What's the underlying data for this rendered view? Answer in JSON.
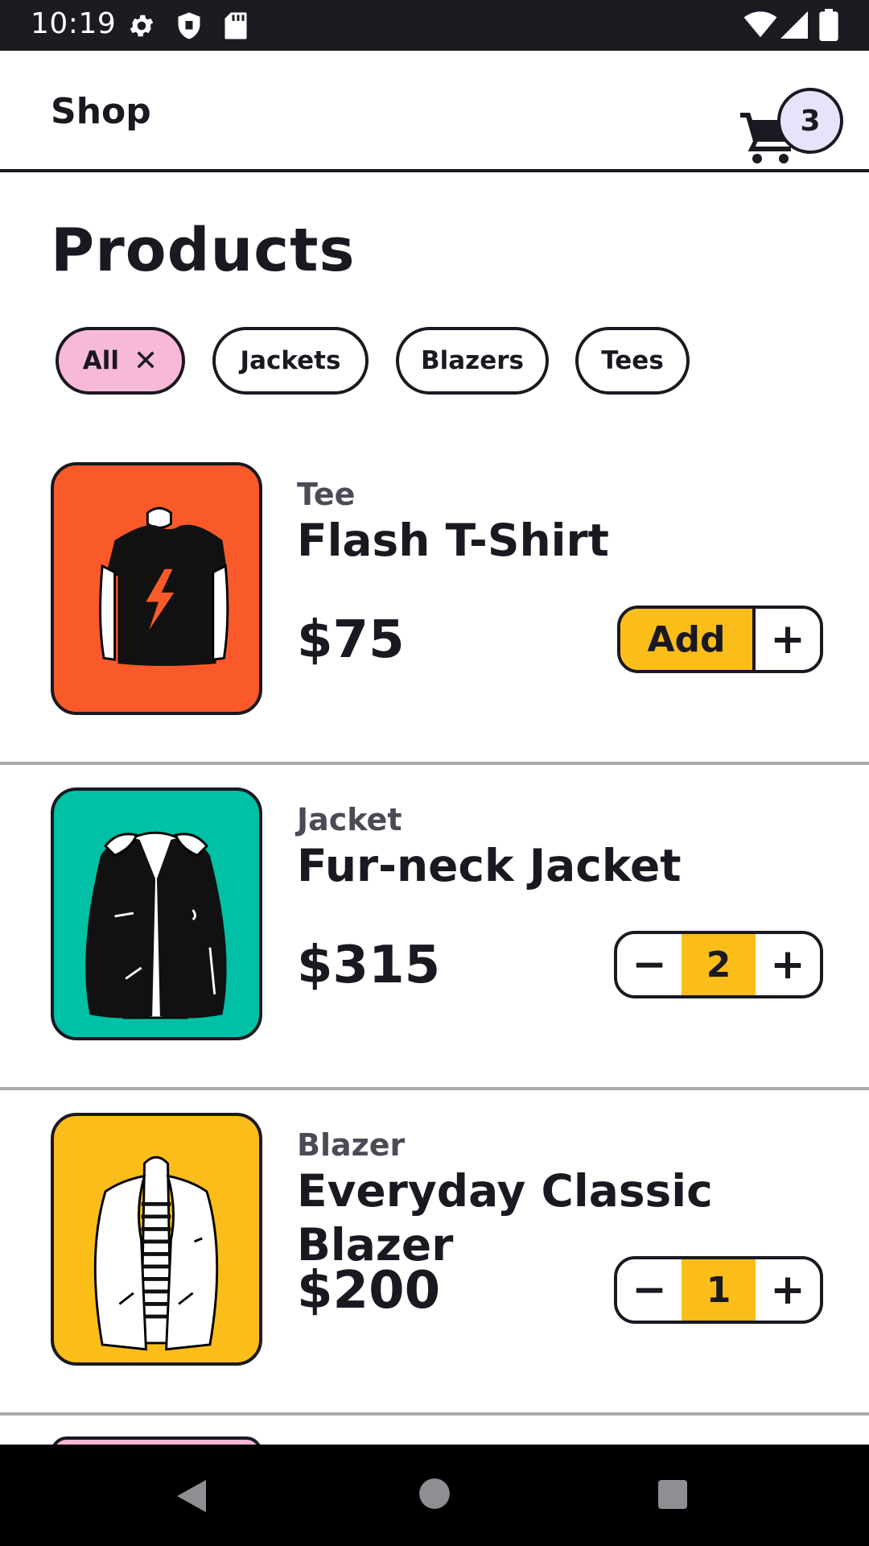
{
  "status_bar": {
    "time": "10:19",
    "icons": [
      "settings-icon",
      "shield-icon",
      "sd-card-icon",
      "wifi-icon",
      "signal-icon",
      "battery-icon"
    ]
  },
  "app_bar": {
    "title": "Shop",
    "cart_count": "3"
  },
  "page": {
    "heading": "Products"
  },
  "filters": [
    {
      "label": "All",
      "active": true
    },
    {
      "label": "Jackets",
      "active": false
    },
    {
      "label": "Blazers",
      "active": false
    },
    {
      "label": "Tees",
      "active": false
    }
  ],
  "products": [
    {
      "category": "Tee",
      "name": "Flash T-Shirt",
      "price": "$75",
      "control": "add",
      "add_label": "Add",
      "thumb_color": "#fa5a2a"
    },
    {
      "category": "Jacket",
      "name": "Fur-neck Jacket",
      "price": "$315",
      "control": "stepper",
      "quantity": "2",
      "thumb_color": "#00c0a6"
    },
    {
      "category": "Blazer",
      "name": "Everyday Classic Blazer",
      "price": "$200",
      "control": "stepper",
      "quantity": "1",
      "thumb_color": "#fbbd1a"
    }
  ],
  "symbols": {
    "plus": "+",
    "minus": "−",
    "close": "✕"
  },
  "colors": {
    "accent_yellow": "#fbbd1a",
    "chip_active_pink": "#f7b9d6",
    "badge_lavender": "#e6e4fb",
    "ink": "#1a1820"
  }
}
